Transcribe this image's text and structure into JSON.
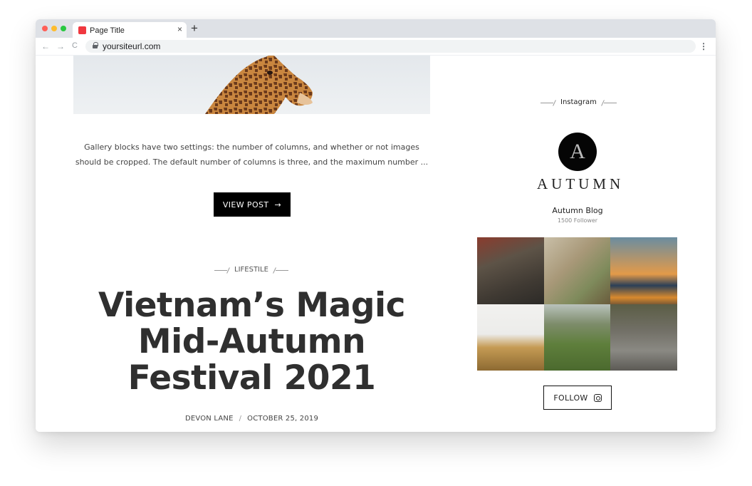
{
  "browser": {
    "tab_title": "Page Title",
    "tab_close": "×",
    "new_tab": "+",
    "url": "yoursiteurl.com",
    "nav_back": "←",
    "nav_forward": "→",
    "nav_reload": "C",
    "menu": "⋮",
    "traffic_lights": [
      "#ff5f57",
      "#febc2e",
      "#28c840"
    ]
  },
  "post": {
    "excerpt": "Gallery blocks have two settings: the number of columns, and whether or not images should be cropped. The default number of columns is three, and the maximum number ...",
    "button_label": "VIEW POST",
    "button_icon": "arrow-right-icon",
    "button_arrow": "→"
  },
  "featured": {
    "category": "LIFESTILE",
    "title": "Vietnam’s Magic Mid-Autumn Festival 2021",
    "author": "DEVON LANE",
    "separator": "/",
    "date": "OCTOBER 25, 2019"
  },
  "sidebar": {
    "heading": "Instagram",
    "avatar_letter": "A",
    "brand": "AUTUMN",
    "blog_name": "Autumn Blog",
    "followers": "1500 Follower",
    "follow_label": "FOLLOW",
    "follow_icon": "instagram-icon",
    "grid_colors": [
      "#6f6355",
      "#b9ab8d",
      "#d89a4a",
      "#d9c79a",
      "#6f8556",
      "#6c6a64"
    ]
  }
}
